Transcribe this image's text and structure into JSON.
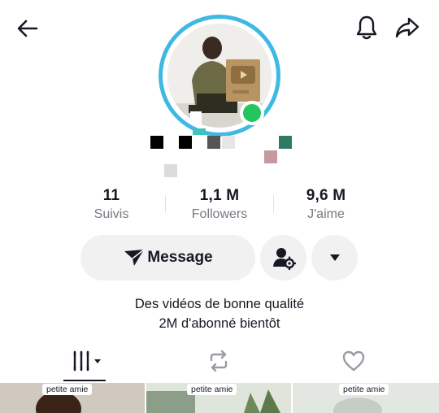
{
  "header": {
    "back_icon": "arrow-left-icon",
    "bell_icon": "bell-icon",
    "share_icon": "share-arrow-icon"
  },
  "avatar": {
    "ring_color": "#3fb8e6",
    "online_color": "#22c55e"
  },
  "stats": [
    {
      "value": "11",
      "label": "Suivis"
    },
    {
      "value": "1,1 M",
      "label": "Followers"
    },
    {
      "value": "9,6 M",
      "label": "J'aime"
    }
  ],
  "actions": {
    "message_label": "Message",
    "message_icon": "send-icon",
    "friend_settings_icon": "user-settings-icon",
    "more_icon": "caret-down-icon"
  },
  "bio": {
    "line1": "Des vidéos de bonne qualité",
    "line2": "2M d'abonné bientôt"
  },
  "tabs": [
    {
      "icon": "videos-grid-icon",
      "active": true
    },
    {
      "icon": "repost-icon",
      "active": false
    },
    {
      "icon": "heart-icon",
      "active": false
    }
  ],
  "videos": [
    {
      "tag": "petite amie"
    },
    {
      "tag": "petite amie"
    },
    {
      "tag": "petite amie"
    }
  ]
}
